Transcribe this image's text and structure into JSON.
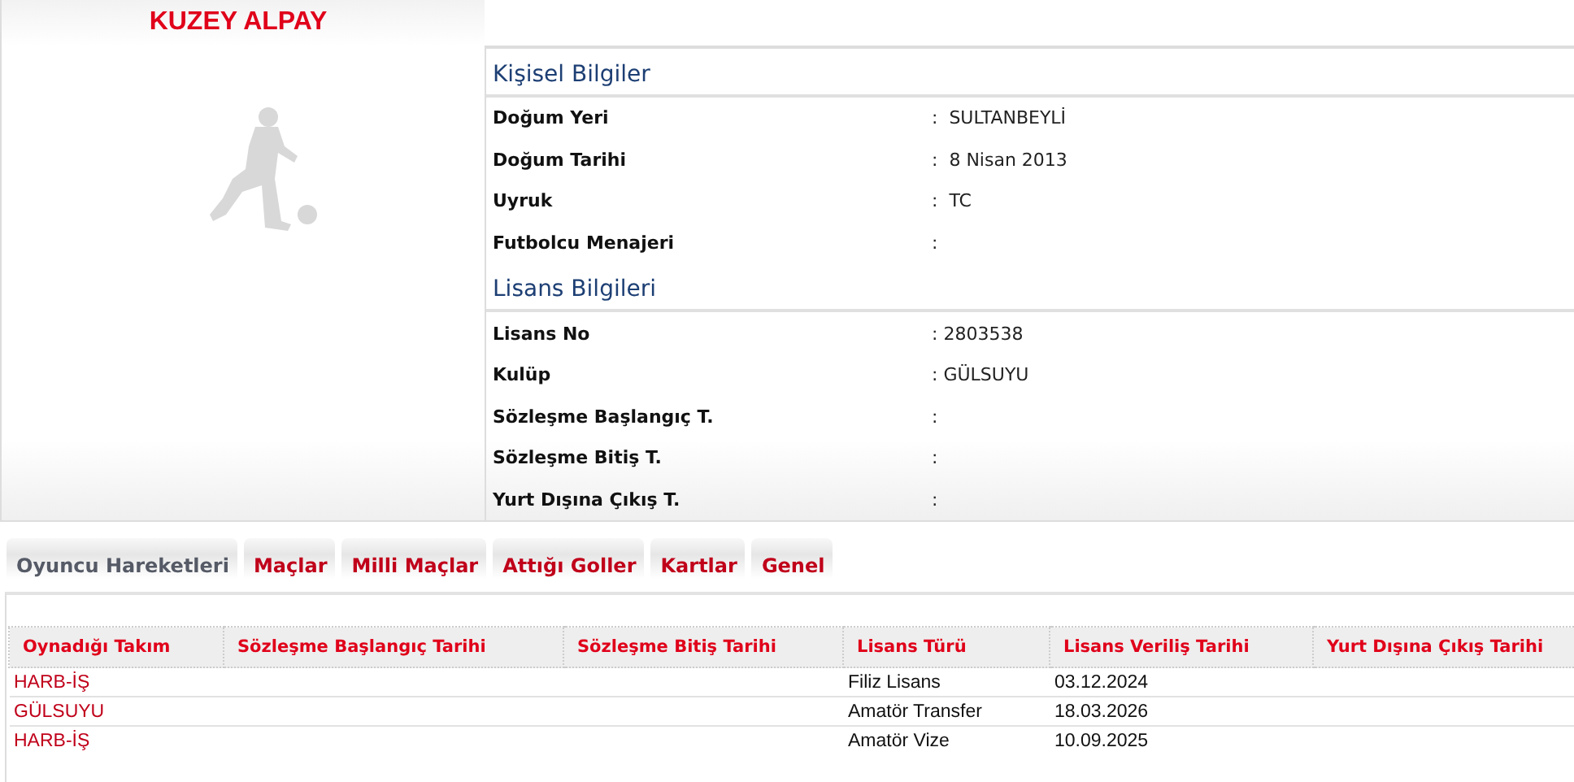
{
  "player": {
    "name": "KUZEY ALPAY"
  },
  "sections": [
    {
      "title": "Kişisel Bilgiler",
      "fields": [
        {
          "label": "Doğum Yeri",
          "value": ":  SULTANBEYLİ"
        },
        {
          "label": "Doğum Tarihi",
          "value": ":  8 Nisan 2013"
        },
        {
          "label": "Uyruk",
          "value": ":  TC"
        },
        {
          "label": "Futbolcu Menajeri",
          "value": ":"
        }
      ]
    },
    {
      "title": "Lisans Bilgileri",
      "fields": [
        {
          "label": "Lisans No",
          "value": ": 2803538"
        },
        {
          "label": "Kulüp",
          "value": ": GÜLSUYU"
        },
        {
          "label": "Sözleşme Başlangıç T.",
          "value": ":"
        },
        {
          "label": "Sözleşme Bitiş T.",
          "value": ":"
        },
        {
          "label": "Yurt Dışına Çıkış T.",
          "value": ":"
        }
      ]
    }
  ],
  "tabs": [
    {
      "label": "Oyuncu Hareketleri",
      "selected": true
    },
    {
      "label": "Maçlar",
      "selected": false
    },
    {
      "label": "Milli Maçlar",
      "selected": false
    },
    {
      "label": "Attığı Goller",
      "selected": false
    },
    {
      "label": "Kartlar",
      "selected": false
    },
    {
      "label": "Genel",
      "selected": false
    }
  ],
  "table": {
    "columns": [
      "Oynadığı Takım",
      "Sözleşme Başlangıç Tarihi",
      "Sözleşme Bitiş Tarihi",
      "Lisans Türü",
      "Lisans Veriliş Tarihi",
      "Yurt Dışına Çıkış Tarihi"
    ],
    "rows": [
      [
        "HARB-İŞ",
        null,
        null,
        "Filiz Lisans",
        "03.12.2024",
        null
      ],
      [
        "GÜLSUYU",
        null,
        null,
        "Amatör Transfer",
        "18.03.2026",
        null
      ],
      [
        "HARB-İŞ",
        null,
        null,
        "Amatör Vize",
        "10.09.2025",
        null
      ]
    ]
  }
}
